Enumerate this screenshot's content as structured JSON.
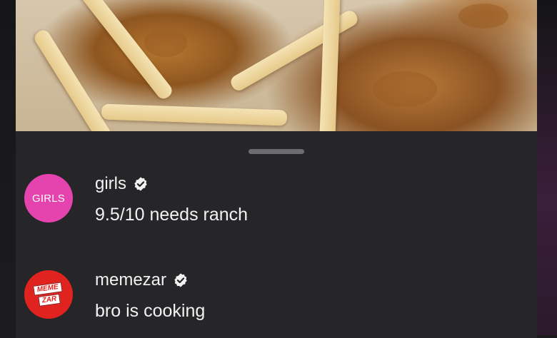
{
  "photo": {
    "subject": "fried chicken tenders and fries"
  },
  "comments": [
    {
      "username": "girls",
      "avatar_text": "GIRLS",
      "avatar_color": "#e543ad",
      "verified": true,
      "text": "9.5/10 needs ranch"
    },
    {
      "username": "memezar",
      "avatar_text_lines": [
        "MEME",
        "ZAR"
      ],
      "avatar_color": "#e1231f",
      "verified": true,
      "text": "bro is cooking"
    }
  ],
  "icons": {
    "verified": "verified-badge-icon"
  },
  "colors": {
    "sheet_bg": "#262528",
    "text": "#f2f2f2"
  }
}
